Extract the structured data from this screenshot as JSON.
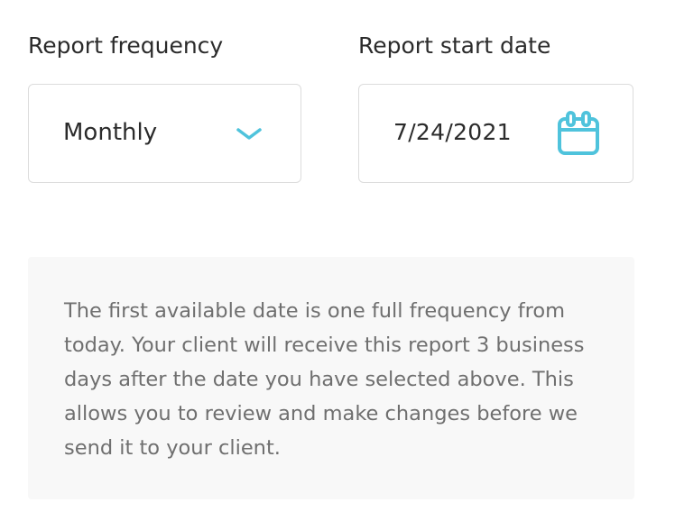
{
  "frequency": {
    "label": "Report frequency",
    "selected": "Monthly"
  },
  "start_date": {
    "label": "Report start date",
    "value": "7/24/2021"
  },
  "info": {
    "text": "The first available date is one full frequency from today. Your client will receive this report 3 business days after the date you have selected above. This allows you to review and make changes before we send it to your client."
  },
  "colors": {
    "accent": "#4fc3dc",
    "border": "#dcdcdc",
    "panel_bg": "#f8f8f8",
    "text": "#2b2b2b",
    "muted_text": "#6f6f6f"
  },
  "icons": {
    "dropdown": "chevron-down-icon",
    "date": "calendar-icon"
  }
}
